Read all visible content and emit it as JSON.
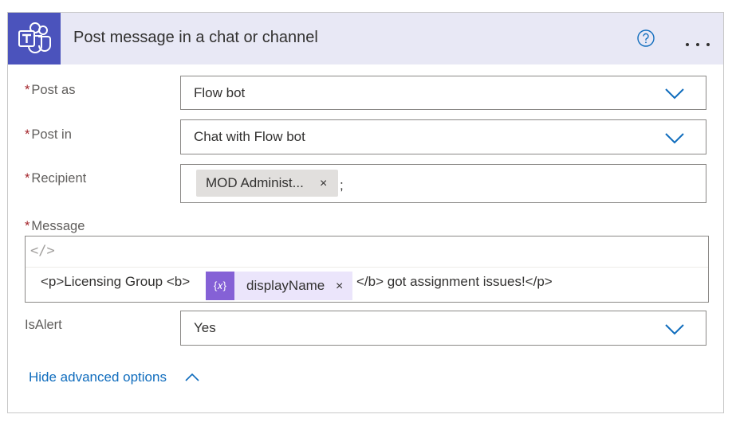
{
  "header": {
    "title": "Post message in a chat or channel"
  },
  "fields": {
    "post_as": {
      "label": "Post as",
      "required_mark": "*",
      "value": "Flow bot"
    },
    "post_in": {
      "label": "Post in",
      "required_mark": "*",
      "value": "Chat with Flow bot"
    },
    "recipient": {
      "label": "Recipient",
      "required_mark": "*",
      "token": "MOD Administ...",
      "token_close": "×",
      "separator": ";"
    },
    "message": {
      "label": "Message",
      "required_mark": "*",
      "code_toggle": "</>",
      "text_before": "<p>Licensing Group <b>",
      "dynamic_icon": "{𝑥}",
      "dynamic_token": "displayName",
      "dynamic_close": "×",
      "text_after": "</b> got assignment issues!</p>"
    },
    "is_alert": {
      "label": "IsAlert",
      "value": "Yes"
    }
  },
  "advanced": {
    "label": "Hide advanced options"
  },
  "colors": {
    "teams_purple": "#4b53bc",
    "header_bg": "#e8e8f5",
    "link_blue": "#0f6cbd",
    "required_red": "#a4262c",
    "dynamic_purple": "#8561d6"
  },
  "icons": [
    "teams-icon",
    "help-icon",
    "more-options-icon",
    "chevron-down-icon",
    "close-icon",
    "code-view-icon",
    "expression-icon",
    "chevron-up-icon"
  ]
}
